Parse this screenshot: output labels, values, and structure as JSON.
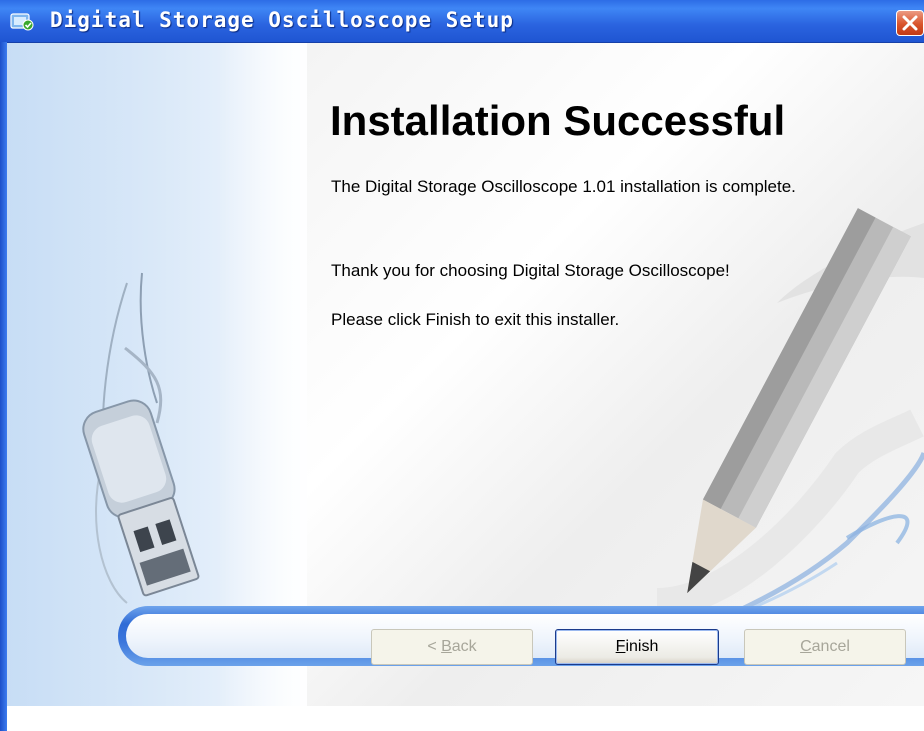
{
  "window": {
    "title": "Digital Storage Oscilloscope Setup",
    "icon": "installer-icon",
    "close_icon": "close-icon"
  },
  "content": {
    "heading": "Installation Successful",
    "paragraph1": "The Digital Storage Oscilloscope 1.01 installation is complete.",
    "paragraph2": "Thank you for choosing Digital Storage Oscilloscope!",
    "paragraph3": "Please click Finish to exit this installer."
  },
  "buttons": {
    "back": {
      "prefix": "< ",
      "mnemonic": "B",
      "rest": "ack",
      "enabled": false
    },
    "finish": {
      "mnemonic": "F",
      "rest": "inish",
      "enabled": true
    },
    "cancel": {
      "mnemonic": "C",
      "rest": "ancel",
      "enabled": false
    }
  },
  "illustrations": {
    "left": "usb-drive-illustration",
    "right": "pencil-drawing-illustration"
  },
  "colors": {
    "titlebar": "#2a63df",
    "close_button": "#d9542c",
    "button_bar": "#2f6bd6"
  }
}
